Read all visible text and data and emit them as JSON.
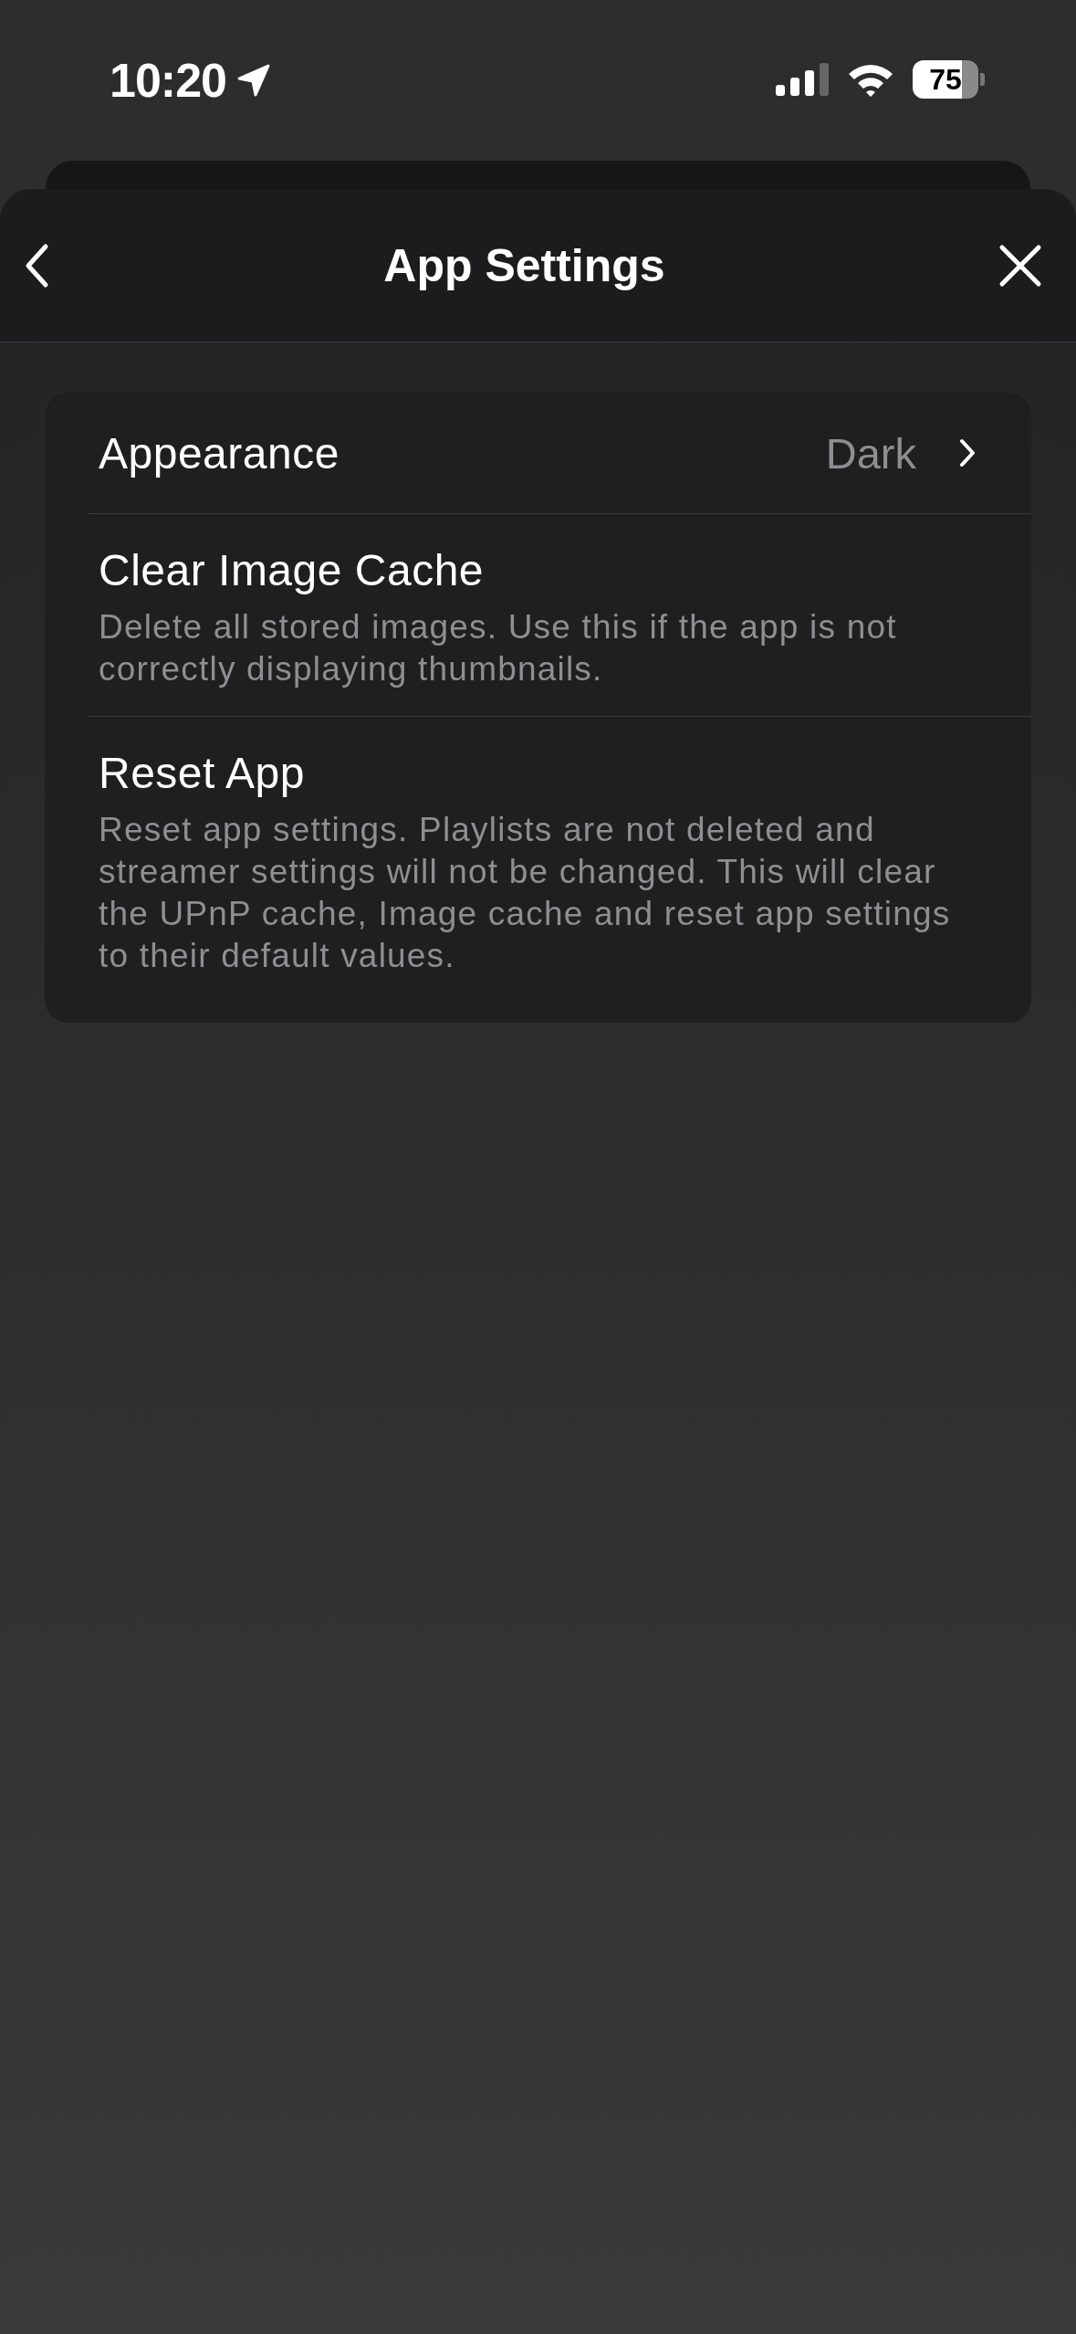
{
  "status_bar": {
    "time": "10:20",
    "battery": "75"
  },
  "header": {
    "title": "App Settings"
  },
  "settings": [
    {
      "kind": "link",
      "label": "Appearance",
      "value": "Dark"
    },
    {
      "kind": "action",
      "label": "Clear Image Cache",
      "description": "Delete all stored images. Use this if the app is not correctly displaying thumbnails."
    },
    {
      "kind": "action",
      "label": "Reset App",
      "description": "Reset app settings. Playlists are not deleted and streamer settings will not be changed. This will clear the UPnP cache, Image cache and reset app settings to their default values."
    }
  ]
}
